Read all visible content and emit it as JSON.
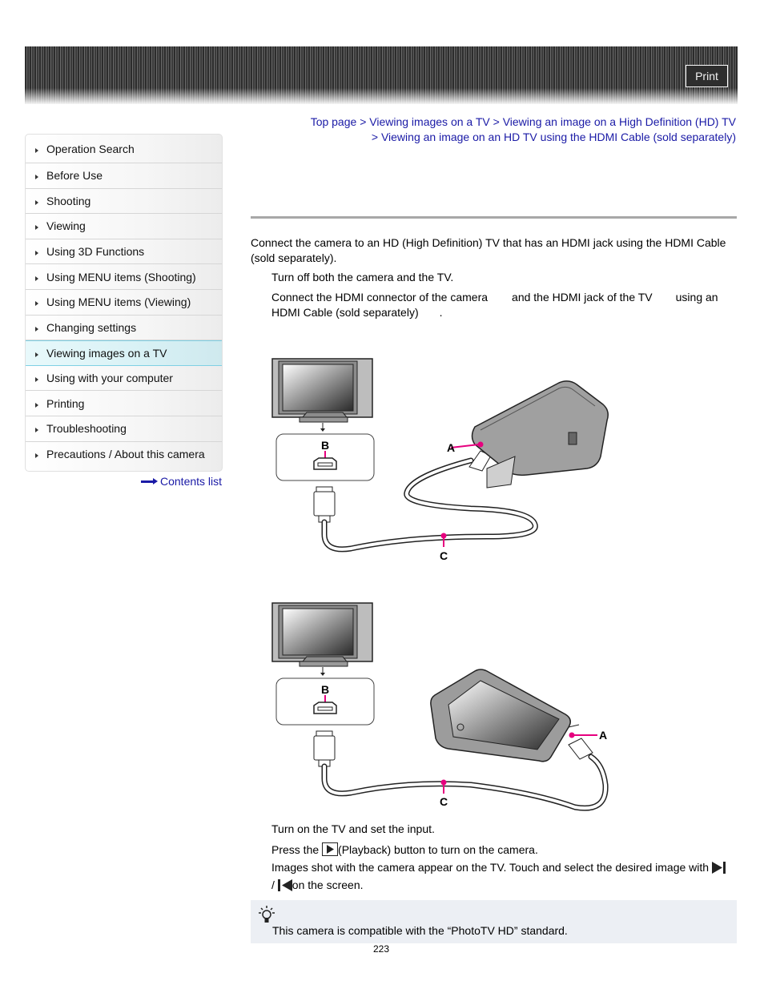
{
  "header": {
    "print_label": "Print"
  },
  "sidebar": {
    "items": [
      {
        "label": "Operation Search"
      },
      {
        "label": "Before Use"
      },
      {
        "label": "Shooting"
      },
      {
        "label": "Viewing"
      },
      {
        "label": "Using 3D Functions"
      },
      {
        "label": "Using MENU items (Shooting)"
      },
      {
        "label": "Using MENU items (Viewing)"
      },
      {
        "label": "Changing settings"
      },
      {
        "label": "Viewing images on a TV",
        "active": true
      },
      {
        "label": "Using with your computer"
      },
      {
        "label": "Printing"
      },
      {
        "label": "Troubleshooting"
      },
      {
        "label": "Precautions / About this camera"
      }
    ],
    "contents_link": "Contents list"
  },
  "breadcrumb": {
    "items": [
      "Top page",
      "Viewing images on a TV",
      "Viewing an image on a High Definition (HD) TV",
      "Viewing an image on an HD TV using the HDMI Cable (sold separately)"
    ],
    "separator": ">"
  },
  "content": {
    "intro": "Connect the camera to an HD (High Definition) TV that has an HDMI jack using the HDMI Cable (sold separately).",
    "step1": "Turn off both the camera and the TV.",
    "step2_part1": "Connect the HDMI connector of the camera",
    "step2_part2": "and the HDMI jack of the TV",
    "step2_part3": "using an",
    "step2_part4": "HDMI Cable (sold separately)",
    "step2_part5": ".",
    "diagram_labels": {
      "a": "A",
      "b": "B",
      "c": "C"
    },
    "step3": "Turn on the TV and set the input.",
    "step4_part1": "Press the",
    "step4_part2": "(Playback) button to turn on the camera.",
    "step4_line2_part1": "Images shot with the camera appear on the TV. Touch and select the desired image with",
    "step4_line3_part1": "/",
    "step4_line3_part2": "on the screen."
  },
  "hint": {
    "icon": "lightbulb-icon",
    "text": "This camera is compatible with the “PhotoTV HD” standard."
  },
  "footer": {
    "page_number": "223"
  },
  "colors": {
    "link": "#1a1aa6",
    "accent_magenta": "#e6007e",
    "active_nav_border": "#7fd0e4",
    "hint_bg": "#eceff4"
  }
}
